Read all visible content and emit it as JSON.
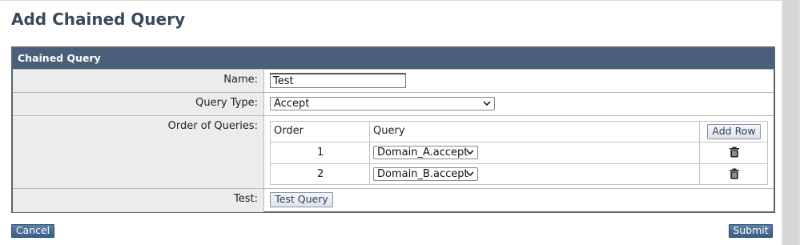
{
  "page": {
    "title": "Add Chained Query"
  },
  "panel": {
    "header": "Chained Query",
    "name": {
      "label": "Name:",
      "value": "Test"
    },
    "query_type": {
      "label": "Query Type:",
      "value": "Accept"
    },
    "order_of_queries": {
      "label": "Order of Queries:",
      "columns": {
        "order": "Order",
        "query": "Query"
      },
      "add_row_label": "Add Row",
      "rows": [
        {
          "order": "1",
          "query": "Domain_A.accept"
        },
        {
          "order": "2",
          "query": "Domain_B.accept"
        }
      ]
    },
    "test": {
      "label": "Test:",
      "button_label": "Test Query"
    }
  },
  "footer": {
    "cancel_label": "Cancel",
    "submit_label": "Submit"
  },
  "icons": {
    "delete_row": "trash-icon",
    "dropdown": "chevron-down-icon"
  },
  "colors": {
    "header_bg": "#4a5f7a",
    "title": "#39495c",
    "label_bg": "#ececec",
    "primary_button": "#3b5f87"
  }
}
